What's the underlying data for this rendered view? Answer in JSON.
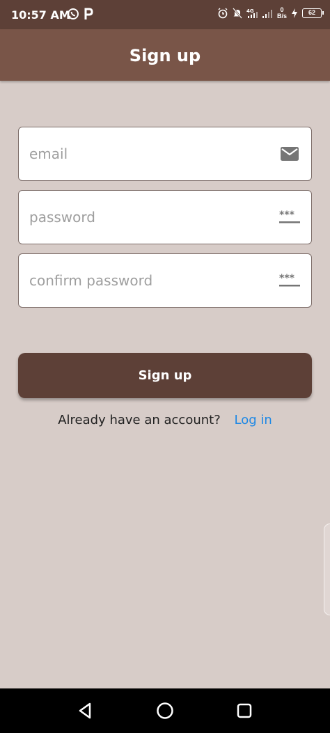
{
  "status_bar": {
    "time": "10:57 AM",
    "left_icons": [
      "whatsapp-icon",
      "paytm-icon"
    ],
    "right_icons": [
      "alarm-icon",
      "mute-icon",
      "signal-4g-icon",
      "signal-icon"
    ],
    "net_speed_value": "0",
    "net_speed_unit": "B/s",
    "battery_level": "62"
  },
  "app_bar": {
    "title": "Sign up"
  },
  "form": {
    "email_placeholder": "email",
    "email_icon": "mail-icon",
    "password_placeholder": "password",
    "password_icon": "password-icon",
    "confirm_placeholder": "confirm password",
    "confirm_icon": "password-icon"
  },
  "signup_button_label": "Sign up",
  "account_prompt": "Already have an account?",
  "login_link": "Log in",
  "nav": [
    "back-icon",
    "home-icon",
    "recents-icon"
  ],
  "colors": {
    "status_bar": "#5d4037",
    "app_bar": "#795548",
    "background": "#d7ccc8",
    "button": "#5d4037",
    "link": "#1e88e5"
  }
}
